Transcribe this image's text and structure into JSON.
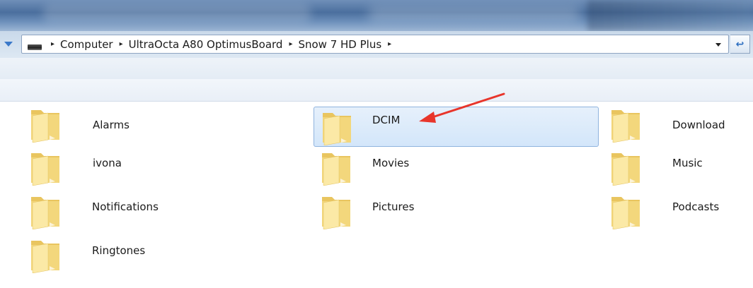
{
  "address_bar": {
    "crumbs": [
      "Computer",
      "UltraOcta A80 OptimusBoard",
      "Snow 7 HD Plus"
    ],
    "trailing_separator": "▸"
  },
  "refresh_glyph": "↩",
  "folders": [
    {
      "name": "Alarms"
    },
    {
      "name": "DCIM",
      "selected": true
    },
    {
      "name": "Download"
    },
    {
      "name": "ivona"
    },
    {
      "name": "Movies"
    },
    {
      "name": "Music"
    },
    {
      "name": "Notifications"
    },
    {
      "name": "Pictures"
    },
    {
      "name": "Podcasts"
    },
    {
      "name": "Ringtones"
    }
  ],
  "colors": {
    "folder_body": "#f3d77c",
    "folder_front": "#fbe9a6",
    "selection": "#cfe3f8",
    "annotation_arrow": "#e8352b"
  }
}
